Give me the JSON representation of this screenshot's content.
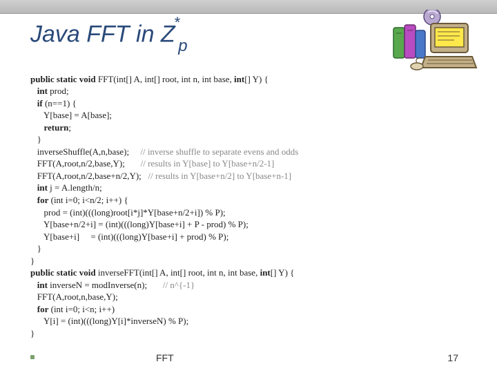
{
  "slide": {
    "title_base": "Java FFT in Z",
    "title_sup": "*",
    "title_sub": "p",
    "footer_label": "FFT",
    "page_number": "17"
  },
  "code": {
    "l01a": "public static void",
    "l01b": " FFT(int[] A, int[] root, int n, int base, ",
    "l01c": "int",
    "l01d": "[] Y) {",
    "l02a": "   int",
    "l02b": " prod;",
    "l03a": "   if",
    "l03b": " (n==1) {",
    "l04": "      Y[base] = A[base];",
    "l05a": "      return",
    "l05b": ";",
    "l06": "   }",
    "l07a": "   inverseShuffle(A,n,base);     ",
    "l07c": "// inverse shuffle to separate evens and odds",
    "l08a": "   FFT(A,root,n/2,base,Y);       ",
    "l08c": "// results in Y[base] to Y[base+n/2-1]",
    "l09a": "   FFT(A,root,n/2,base+n/2,Y);   ",
    "l09c": "// results in Y[base+n/2] to Y[base+n-1]",
    "l10a": "   int",
    "l10b": " j = A.length/n;",
    "l11a": "   for",
    "l11b": " (int i=0; i<n/2; i++) {",
    "l12": "      prod = (int)(((long)root[i*j]*Y[base+n/2+i]) % P);",
    "l13": "      Y[base+n/2+i] = (int)(((long)Y[base+i] + P - prod) % P);",
    "l14": "      Y[base+i]     = (int)(((long)Y[base+i] + prod) % P);",
    "l15": "   }",
    "l16": "}",
    "l17a": "public static void",
    "l17b": " inverseFFT(int[] A, int[] root, int n, int base, ",
    "l17c": "int",
    "l17d": "[] Y) {",
    "l18a": "   int",
    "l18b": " inverseN = modInverse(n);       ",
    "l18c": "// n^{-1}",
    "l19": "   FFT(A,root,n,base,Y);",
    "l20a": "   for",
    "l20b": " (int i=0; i<n; i++)",
    "l21": "      Y[i] = (int)(((long)Y[i]*inverseN) % P);",
    "l22": "}"
  }
}
